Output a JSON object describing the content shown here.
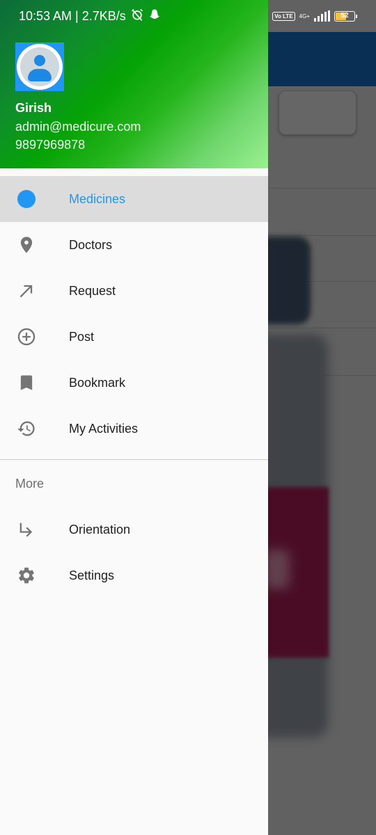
{
  "status_bar": {
    "time_speed": "10:53 AM | 2.7KB/s",
    "volte": "Vo LTE",
    "network": "4G+",
    "battery_level": "52"
  },
  "drawer": {
    "user": {
      "name": "Girish",
      "email": "admin@medicure.com",
      "phone": "9897969878"
    },
    "items": [
      {
        "label": "Medicines",
        "icon": "circle-icon",
        "selected": true
      },
      {
        "label": "Doctors",
        "icon": "location-pin-icon"
      },
      {
        "label": "Request",
        "icon": "arrow-up-right-icon"
      },
      {
        "label": "Post",
        "icon": "plus-circle-icon"
      },
      {
        "label": "Bookmark",
        "icon": "bookmark-icon"
      },
      {
        "label": "My Activities",
        "icon": "history-icon"
      }
    ],
    "more_section_label": "More",
    "more_items": [
      {
        "label": "Orientation",
        "icon": "subdirectory-arrow-icon"
      },
      {
        "label": "Settings",
        "icon": "gear-icon"
      }
    ]
  },
  "colors": {
    "accent": "#2196f3",
    "icon_gray": "#757575",
    "selected_bg": "#dcdcdc"
  }
}
